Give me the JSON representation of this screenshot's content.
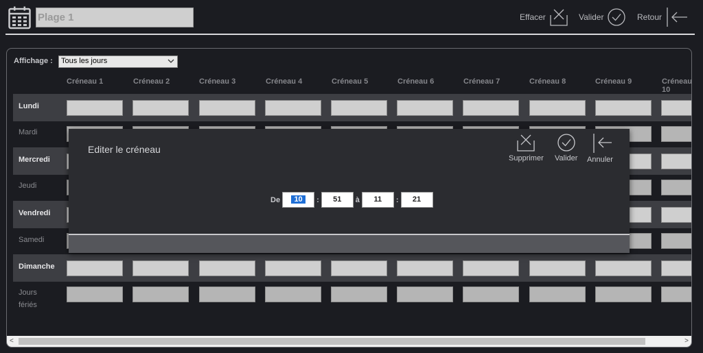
{
  "header": {
    "title_value": "Plage 1",
    "actions": [
      {
        "label": "Effacer",
        "icon": "clear-x-box-icon"
      },
      {
        "label": "Valider",
        "icon": "check-circle-icon"
      },
      {
        "label": "Retour",
        "icon": "arrow-left-icon"
      }
    ]
  },
  "filter": {
    "label": "Affichage :",
    "selected": "Tous les jours"
  },
  "columns": [
    "Créneau 1",
    "Créneau 2",
    "Créneau 3",
    "Créneau 4",
    "Créneau 5",
    "Créneau 6",
    "Créneau 7",
    "Créneau 8",
    "Créneau 9",
    "Créneau 10"
  ],
  "days": [
    "Lundi",
    "Mardi",
    "Mercredi",
    "Jeudi",
    "Vendredi",
    "Samedi",
    "Dimanche",
    "Jours fériés"
  ],
  "modal": {
    "title": "Editer le créneau",
    "actions": [
      {
        "label": "Supprimer",
        "icon": "delete-x-box-icon"
      },
      {
        "label": "Valider",
        "icon": "check-circle-icon"
      },
      {
        "label": "Annuler",
        "icon": "arrow-left-icon"
      }
    ],
    "from_label": "De",
    "to_label": "à",
    "colon": ":",
    "start_hour": "10",
    "start_minute": "51",
    "end_hour": "11",
    "end_minute": "21"
  }
}
